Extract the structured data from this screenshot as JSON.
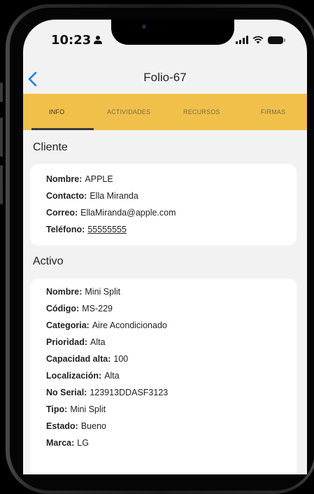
{
  "status": {
    "time": "10:23"
  },
  "nav": {
    "title": "Folio-67"
  },
  "tabs": [
    "INFO",
    "ACTIVIDADES",
    "RECURSOS",
    "FIRMAS"
  ],
  "cliente": {
    "title": "Cliente",
    "fields": [
      {
        "label": "Nombre:",
        "value": "APPLE"
      },
      {
        "label": "Contacto:",
        "value": "Ella Miranda"
      },
      {
        "label": "Correo:",
        "value": "EllaMiranda@apple.com"
      },
      {
        "label": "Teléfono:",
        "value": "55555555"
      }
    ]
  },
  "activo": {
    "title": "Activo",
    "fields": [
      {
        "label": "Nombre:",
        "value": "Mini Split"
      },
      {
        "label": "Código:",
        "value": "MS-229"
      },
      {
        "label": "Categoria:",
        "value": "Aire Acondicionado"
      },
      {
        "label": "Prioridad:",
        "value": "Alta"
      },
      {
        "label": "Capacidad alta:",
        "value": "100"
      },
      {
        "label": "Localización:",
        "value": "Alta"
      },
      {
        "label": "No Serial:",
        "value": "123913DDASF3123"
      },
      {
        "label": "Tipo:",
        "value": "Mini Split"
      },
      {
        "label": "Estado:",
        "value": "Bueno"
      },
      {
        "label": "Marca:",
        "value": "LG"
      }
    ]
  },
  "colors": {
    "accent": "#f0c04a",
    "link": "#1a7cf5",
    "background": "#f2f2f2"
  }
}
